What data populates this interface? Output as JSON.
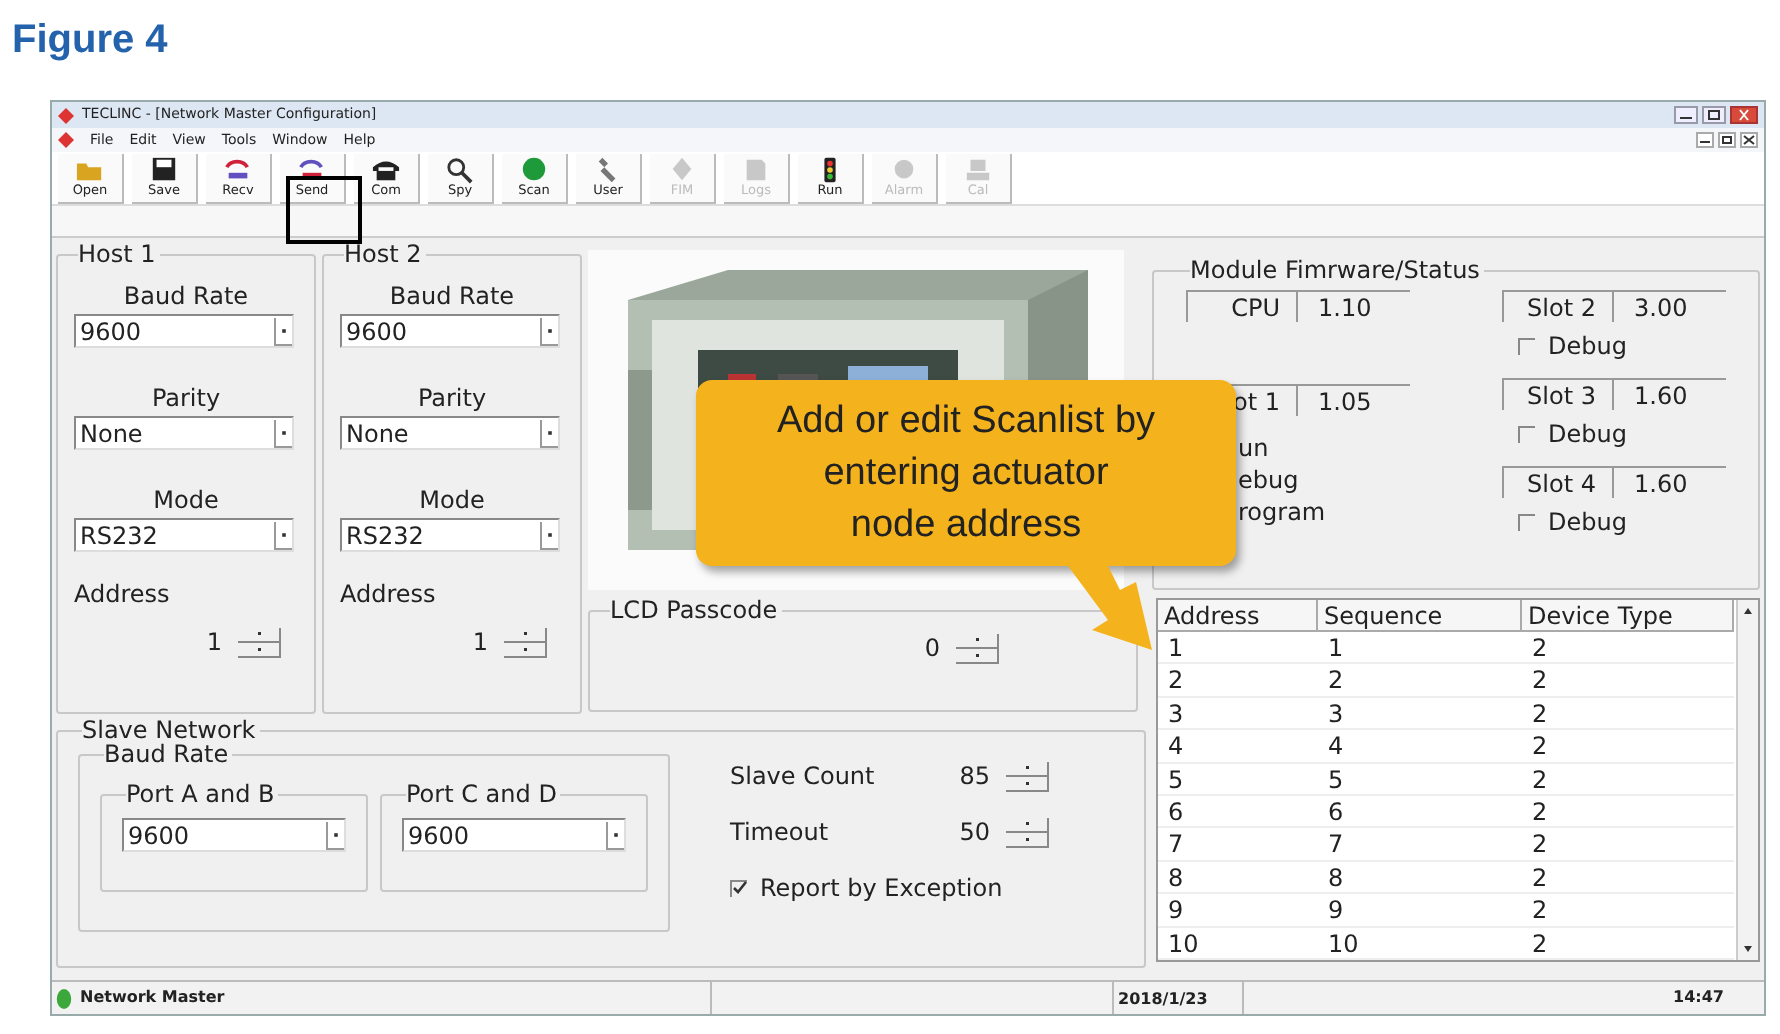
{
  "figure_title": "Figure 4",
  "window": {
    "title": "TECLINC - [Network Master Configuration]"
  },
  "menu": [
    "File",
    "Edit",
    "View",
    "Tools",
    "Window",
    "Help"
  ],
  "toolbar": [
    {
      "label": "Open",
      "kind": "open",
      "disabled": false
    },
    {
      "label": "Save",
      "kind": "save",
      "disabled": false
    },
    {
      "label": "Recv",
      "kind": "recv",
      "disabled": false
    },
    {
      "label": "Send",
      "kind": "send",
      "disabled": false
    },
    {
      "label": "Com",
      "kind": "com",
      "disabled": false
    },
    {
      "label": "Spy",
      "kind": "spy",
      "disabled": false
    },
    {
      "label": "Scan",
      "kind": "scan",
      "disabled": false
    },
    {
      "label": "User",
      "kind": "user",
      "disabled": false
    },
    {
      "label": "FIM",
      "kind": "fim",
      "disabled": true
    },
    {
      "label": "Logs",
      "kind": "logs",
      "disabled": true
    },
    {
      "label": "Run",
      "kind": "run",
      "disabled": false
    },
    {
      "label": "Alarm",
      "kind": "alarm",
      "disabled": true
    },
    {
      "label": "Cal",
      "kind": "cal",
      "disabled": true
    }
  ],
  "hosts": [
    {
      "title": "Host 1",
      "baud_rate_label": "Baud Rate",
      "baud_rate": "9600",
      "parity_label": "Parity",
      "parity": "None",
      "mode_label": "Mode",
      "mode": "RS232",
      "address_label": "Address",
      "address": "1"
    },
    {
      "title": "Host 2",
      "baud_rate_label": "Baud Rate",
      "baud_rate": "9600",
      "parity_label": "Parity",
      "parity": "None",
      "mode_label": "Mode",
      "mode": "RS232",
      "address_label": "Address",
      "address": "1"
    }
  ],
  "lcd_passcode": {
    "title": "LCD Passcode",
    "value": "0"
  },
  "slave_network": {
    "title": "Slave Network",
    "baud_rate_title": "Baud Rate",
    "ports": [
      {
        "title": "Port A and B",
        "value": "9600"
      },
      {
        "title": "Port C and D",
        "value": "9600"
      }
    ],
    "slave_count_label": "Slave Count",
    "slave_count": "85",
    "timeout_label": "Timeout",
    "timeout": "50",
    "report_label": "Report by Exception",
    "report_checked": true
  },
  "module_status": {
    "title": "Module Fimrware/Status",
    "cpu": {
      "label": "CPU",
      "version": "1.10"
    },
    "slot1": {
      "label": "ot 1",
      "version": "1.05"
    },
    "modes": [
      "un",
      "ebug",
      "rogram"
    ],
    "slots": [
      {
        "label": "Slot 2",
        "version": "3.00",
        "debug_label": "Debug",
        "debug_checked": false
      },
      {
        "label": "Slot 3",
        "version": "1.60",
        "debug_label": "Debug",
        "debug_checked": false
      },
      {
        "label": "Slot 4",
        "version": "1.60",
        "debug_label": "Debug",
        "debug_checked": false
      }
    ]
  },
  "scanlist": {
    "columns": [
      "Address",
      "Sequence",
      "Device Type"
    ],
    "rows": [
      [
        "1",
        "1",
        "2"
      ],
      [
        "2",
        "2",
        "2"
      ],
      [
        "3",
        "3",
        "2"
      ],
      [
        "4",
        "4",
        "2"
      ],
      [
        "5",
        "5",
        "2"
      ],
      [
        "6",
        "6",
        "2"
      ],
      [
        "7",
        "7",
        "2"
      ],
      [
        "8",
        "8",
        "2"
      ],
      [
        "9",
        "9",
        "2"
      ],
      [
        "10",
        "10",
        "2"
      ]
    ]
  },
  "callout": {
    "text": "Add or edit Scanlist by entering actuator node address"
  },
  "status_bar": {
    "mode": "Network Master",
    "date": "2018/1/23",
    "time": "14:47"
  }
}
